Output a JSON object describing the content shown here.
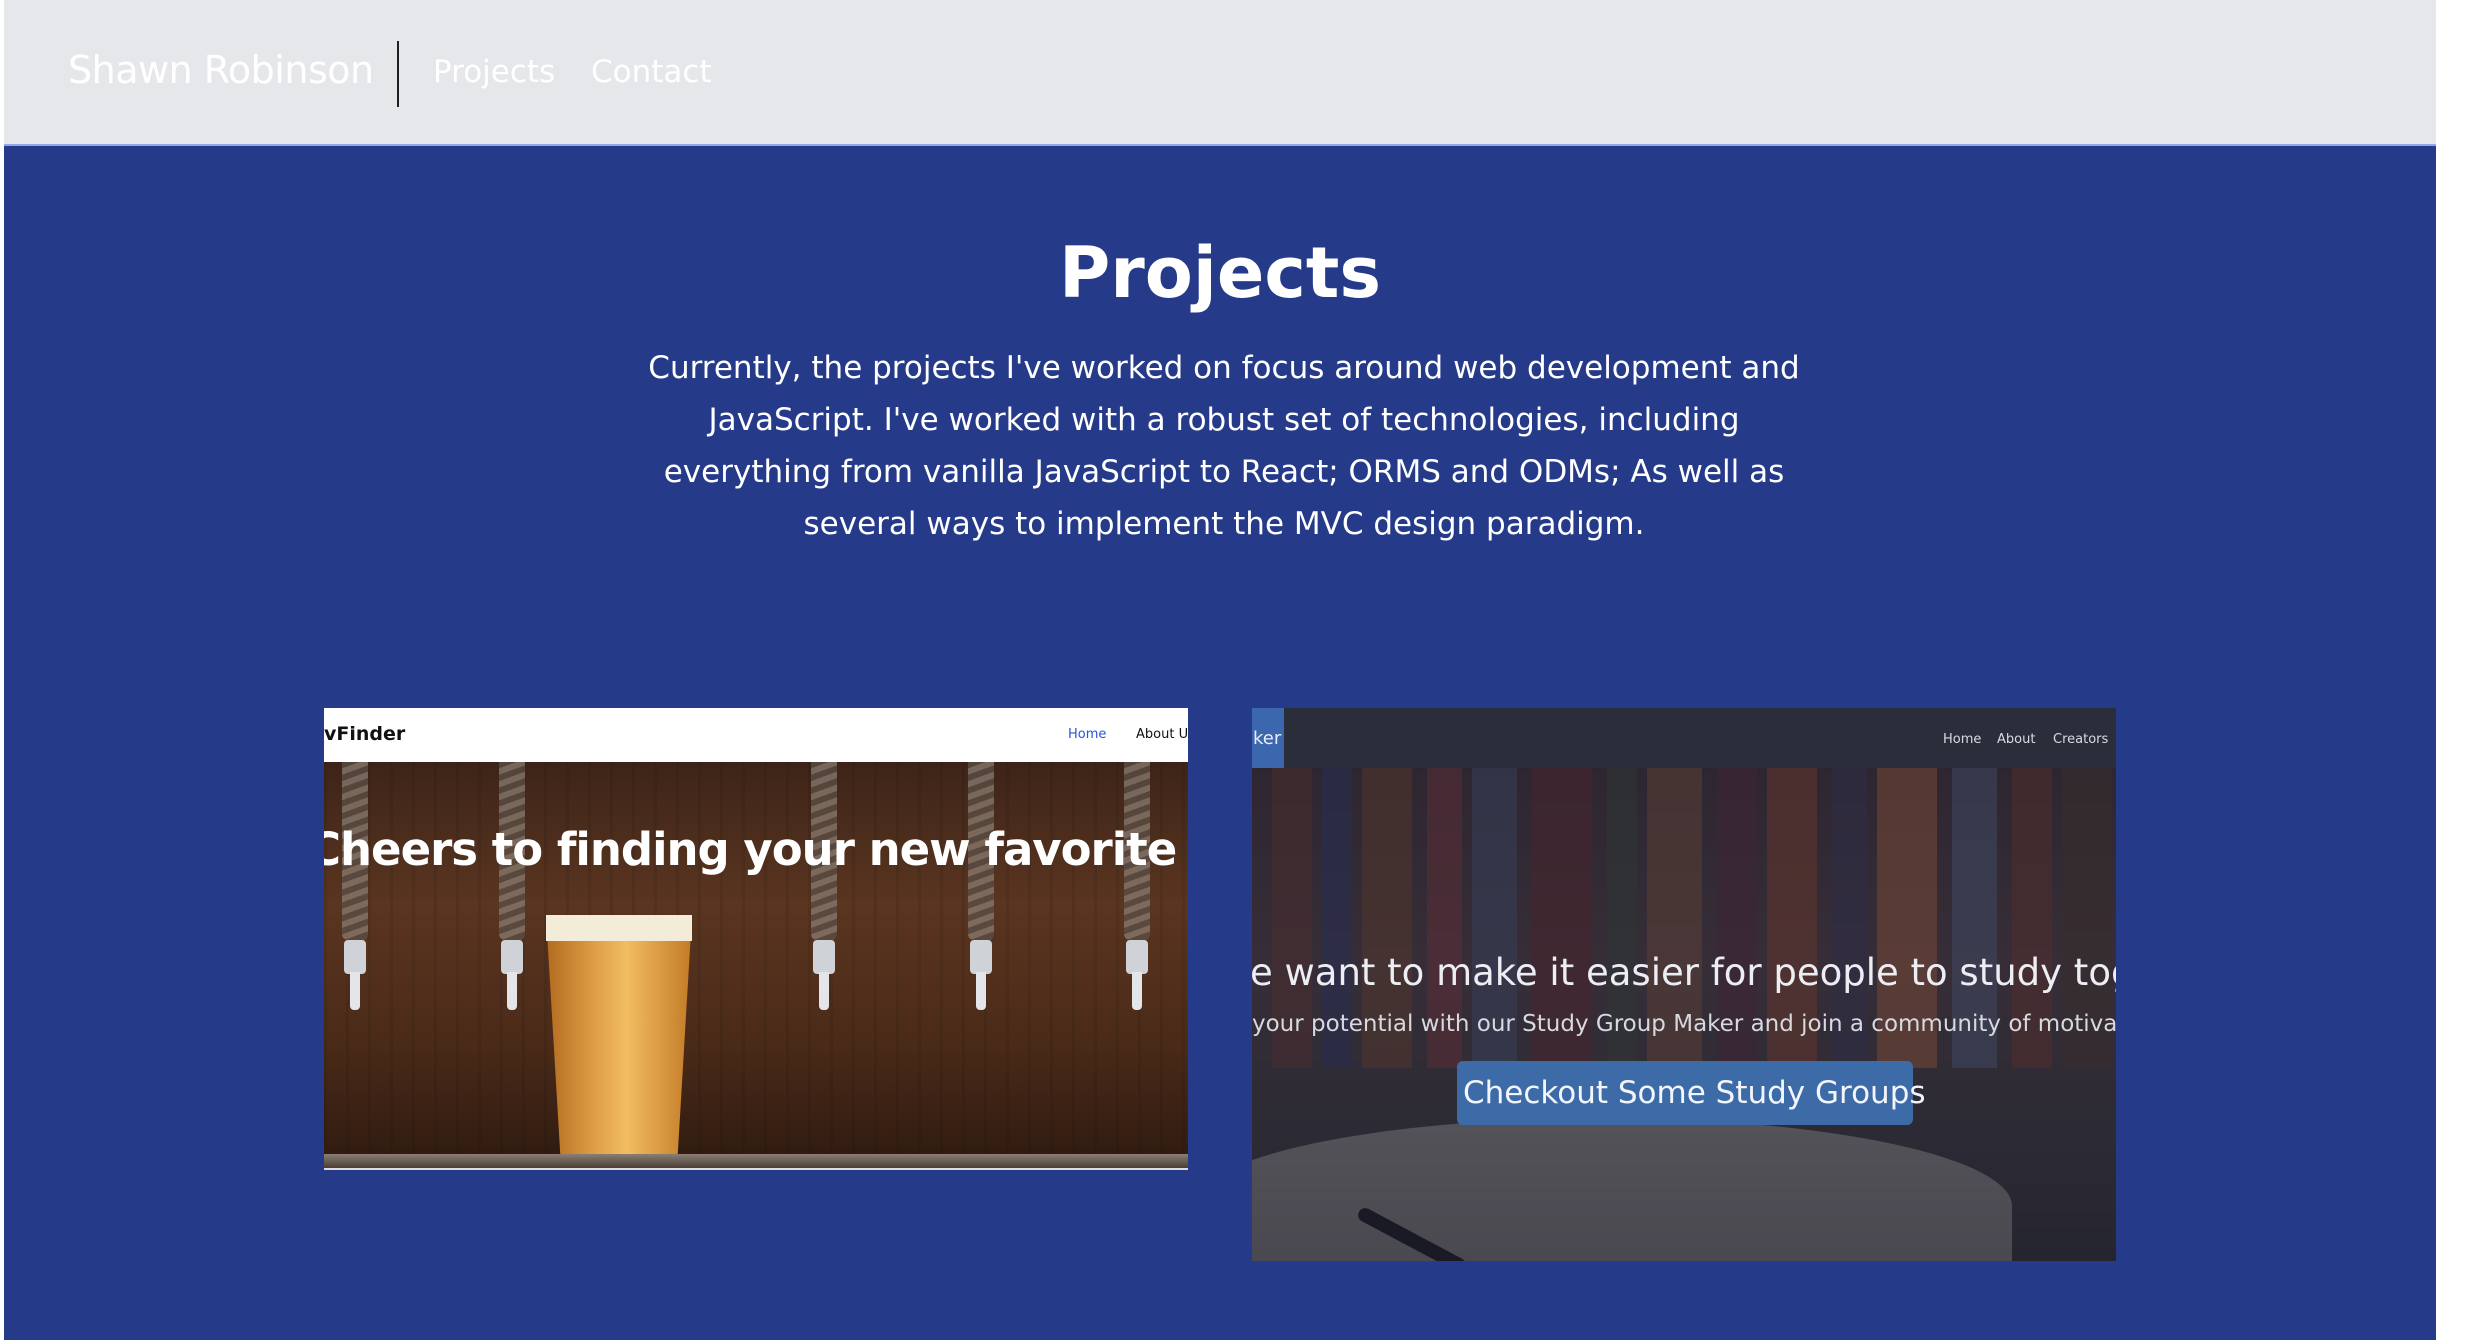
{
  "navbar": {
    "brand": "Shawn Robinson",
    "links": [
      {
        "label": "Projects"
      },
      {
        "label": "Contact"
      }
    ]
  },
  "projects_section": {
    "title": "Projects",
    "intro": "Currently, the projects I've worked on focus around web development and JavaScript. I've worked with a robust set of technologies, including everything from vanilla JavaScript to React; ORMS and ODMs; As well as several ways to implement the MVC design paradigm."
  },
  "project_cards": [
    {
      "nav_logo": "vFinder",
      "nav_links": [
        "Home",
        "About Us"
      ],
      "hero_text": "Cheers to finding your new favorite brewer"
    },
    {
      "nav_logo": "ker",
      "nav_links": [
        "Home",
        "About",
        "Creators"
      ],
      "hero_headline": "e want to make it easier for people to study togethe",
      "hero_subtext": "your potential with our Study Group Maker and join a community of motivated le",
      "cta_label": "Checkout Some Study Groups"
    }
  ],
  "colors": {
    "navbar_bg": "#e6e7ea",
    "main_bg": "#263a8a",
    "cta_bg": "#3d6ba8",
    "brew_link": "#2a56d6"
  }
}
